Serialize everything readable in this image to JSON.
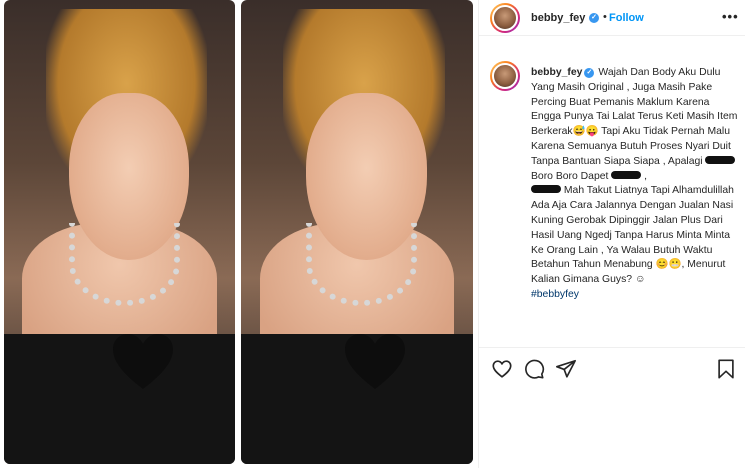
{
  "post": {
    "username": "bebby_fey",
    "verified_mark": "✓",
    "dot": "•",
    "follow_label": "Follow",
    "more_label": "•••"
  },
  "caption": {
    "username": "bebby_fey",
    "segments": {
      "s1": "Wajah Dan Body Aku Dulu Yang Masih Original , Juga Masih Pake Percing Buat Pemanis Maklum Karena Engga Punya Tai Lalat Terus Keti Masih Item Berkerak",
      "e1": "😅😛",
      "s2": " Tapi Aku Tidak Pernah Malu Karena Semuanya Butuh Proses Nyari Duit Tanpa Bantuan Siapa Siapa , Apalagi ",
      "s3": " Boro Boro Dapet ",
      "s4": " , ",
      "s5": " Mah Takut Liatnya Tapi Alhamdulillah Ada Aja Cara Jalannya Dengan Jualan Nasi Kuning Gerobak Dipinggir Jalan Plus Dari Hasil Uang Ngedj Tanpa Harus Minta Minta Ke Orang Lain , Ya Walau Butuh Waktu Betahun Tahun Menabung ",
      "e2": "😊😬",
      "s6": ", Menurut Kalian Gimana Guys? ☺"
    },
    "hashtag": "#bebbyfey"
  },
  "icons": {
    "like": "heart-outline-icon",
    "comment": "speech-bubble-icon",
    "share": "paper-plane-icon",
    "save": "bookmark-icon",
    "photo_overlay": "heart-censor-icon"
  },
  "colors": {
    "follow": "#0095f6",
    "verified": "#3897f0",
    "hashtag": "#00376b",
    "border": "#efefef"
  }
}
